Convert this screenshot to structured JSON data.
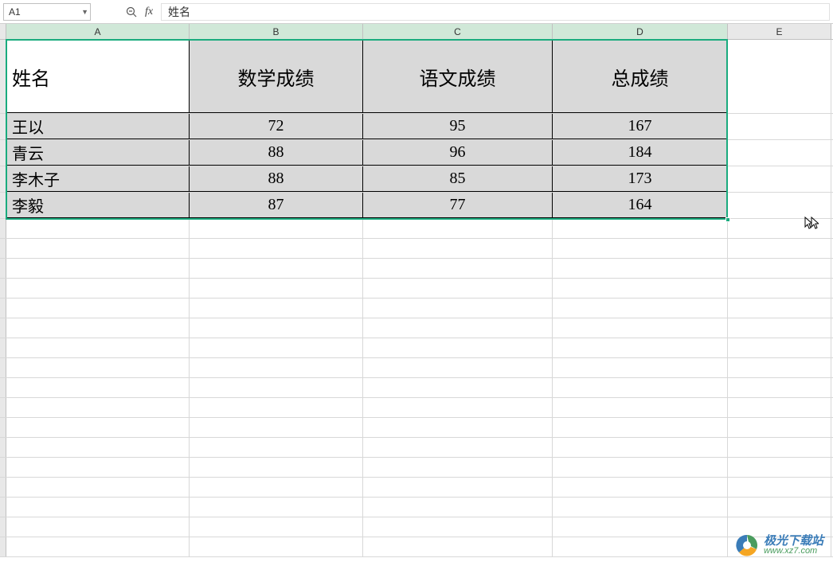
{
  "name_box": "A1",
  "formula_value": "姓名",
  "columns": [
    "A",
    "B",
    "C",
    "D",
    "E"
  ],
  "table": {
    "headers": [
      "姓名",
      "数学成绩",
      "语文成绩",
      "总成绩"
    ],
    "rows": [
      {
        "name": "王以",
        "math": "72",
        "chinese": "95",
        "total": "167"
      },
      {
        "name": "青云",
        "math": "88",
        "chinese": "96",
        "total": "184"
      },
      {
        "name": "李木子",
        "math": "88",
        "chinese": "85",
        "total": "173"
      },
      {
        "name": "李毅",
        "math": "87",
        "chinese": "77",
        "total": "164"
      }
    ]
  },
  "watermark": {
    "title": "极光下载站",
    "url": "www.xz7.com"
  },
  "chart_data": {
    "type": "table",
    "columns": [
      "姓名",
      "数学成绩",
      "语文成绩",
      "总成绩"
    ],
    "rows": [
      [
        "王以",
        72,
        95,
        167
      ],
      [
        "青云",
        88,
        96,
        184
      ],
      [
        "李木子",
        88,
        85,
        173
      ],
      [
        "李毅",
        87,
        77,
        164
      ]
    ]
  }
}
